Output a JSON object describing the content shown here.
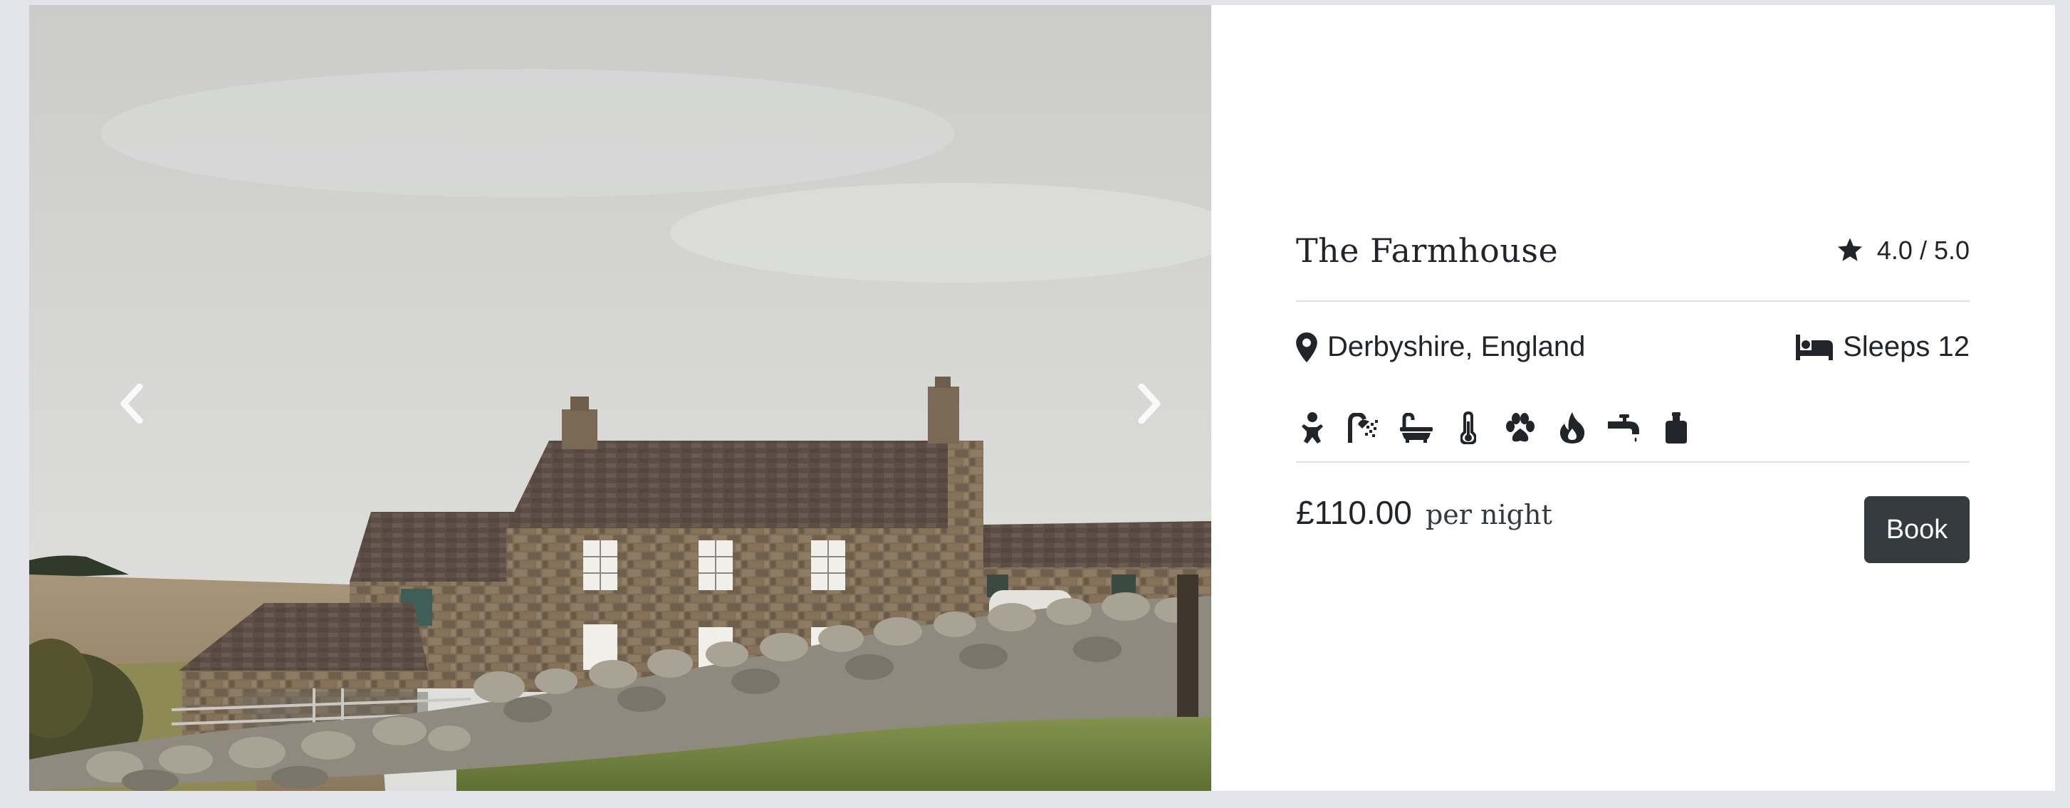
{
  "property": {
    "title": "The Farmhouse",
    "rating": "4.0 / 5.0",
    "location": "Derbyshire, England",
    "sleeps": "Sleeps 12",
    "price": "£110.00",
    "price_unit": "per night",
    "book_label": "Book"
  },
  "carousel": {
    "prev_icon": "chevron-left-icon",
    "next_icon": "chevron-right-icon",
    "image": "stone farmhouse photo"
  },
  "amenities": [
    {
      "icon": "baby-icon"
    },
    {
      "icon": "shower-icon"
    },
    {
      "icon": "bath-icon"
    },
    {
      "icon": "thermometer-icon"
    },
    {
      "icon": "paw-icon"
    },
    {
      "icon": "fire-icon"
    },
    {
      "icon": "faucet-icon"
    },
    {
      "icon": "bottle-icon"
    }
  ],
  "colors": {
    "page_background": "#e2e4ea",
    "card_background": "#ffffff",
    "text": "#212529",
    "button_background": "#343a40",
    "button_text": "#ffffff",
    "divider": "#dee2e6"
  }
}
